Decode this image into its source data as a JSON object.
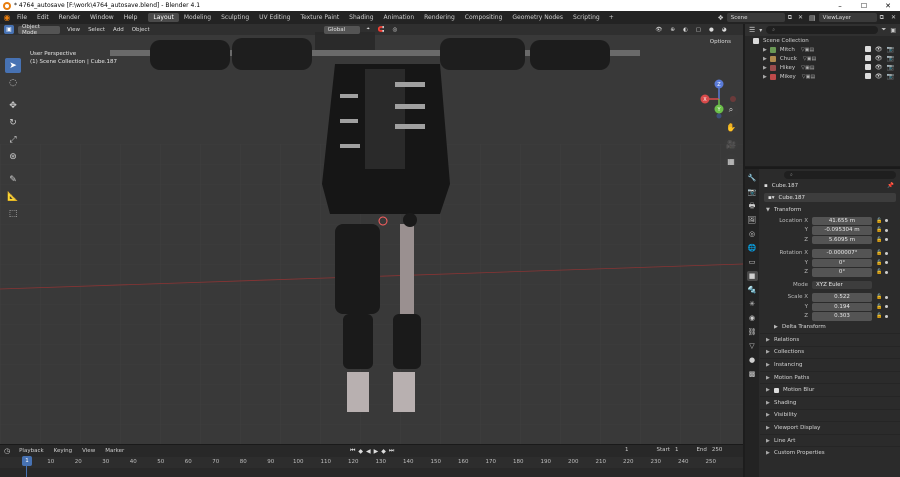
{
  "window": {
    "title": "* 4764_autosave [F:\\work\\4764_autosave.blend] - Blender 4.1",
    "controls": [
      "–",
      "☐",
      "✕"
    ]
  },
  "topbar": {
    "menus": [
      "File",
      "Edit",
      "Render",
      "Window",
      "Help"
    ],
    "workspaces": [
      "Layout",
      "Modeling",
      "Sculpting",
      "UV Editing",
      "Texture Paint",
      "Shading",
      "Animation",
      "Rendering",
      "Compositing",
      "Geometry Nodes",
      "Scripting"
    ],
    "active_workspace": "Layout",
    "add_workspace": "+",
    "scene": "Scene",
    "view_layer": "ViewLayer"
  },
  "viewport": {
    "mode": "Object Mode",
    "menus": [
      "View",
      "Select",
      "Add",
      "Object"
    ],
    "orientation": "Global",
    "options": "Options",
    "perspective": "User Perspective",
    "context": "(1) Scene Collection | Cube.187",
    "gizmo_axes": {
      "x": "X",
      "y": "Y",
      "z": "Z"
    }
  },
  "timeline": {
    "menus": [
      "Playback",
      "Keying",
      "View",
      "Marker"
    ],
    "current_frame": "1",
    "playhead": "1",
    "start_label": "Start",
    "start": "1",
    "end_label": "End",
    "end": "250",
    "ticks": [
      "10",
      "20",
      "30",
      "40",
      "50",
      "60",
      "70",
      "80",
      "90",
      "100",
      "110",
      "120",
      "130",
      "140",
      "150",
      "160",
      "170",
      "180",
      "190",
      "200",
      "210",
      "220",
      "230",
      "240",
      "250"
    ]
  },
  "outliner": {
    "root": "Scene Collection",
    "items": [
      {
        "name": "Mitch",
        "color": "#6a9955"
      },
      {
        "name": "Chuck",
        "color": "#b08b4f"
      },
      {
        "name": "Hikey",
        "color": "#9c4d4d"
      },
      {
        "name": "Mikey",
        "color": "#c04a4a"
      }
    ]
  },
  "properties": {
    "object_name": "Cube.187",
    "object_field": "Cube.187",
    "transform_label": "Transform",
    "location_label": "Location X",
    "location": {
      "x": "41.655 m",
      "y": "-0.095304 m",
      "z": "5.6095 m"
    },
    "rotation_label": "Rotation X",
    "rotation": {
      "x": "-0.000007°",
      "y": "0°",
      "z": "0°"
    },
    "mode_label": "Mode",
    "mode": "XYZ Euler",
    "scale_label": "Scale X",
    "scale": {
      "x": "0.522",
      "y": "0.194",
      "z": "0.303"
    },
    "axis_labels": {
      "y": "Y",
      "z": "Z"
    },
    "delta_transform": "Delta Transform",
    "sections": [
      "Relations",
      "Collections",
      "Instancing",
      "Motion Paths",
      "Motion Blur",
      "Shading",
      "Visibility",
      "Viewport Display",
      "Line Art",
      "Custom Properties"
    ]
  }
}
